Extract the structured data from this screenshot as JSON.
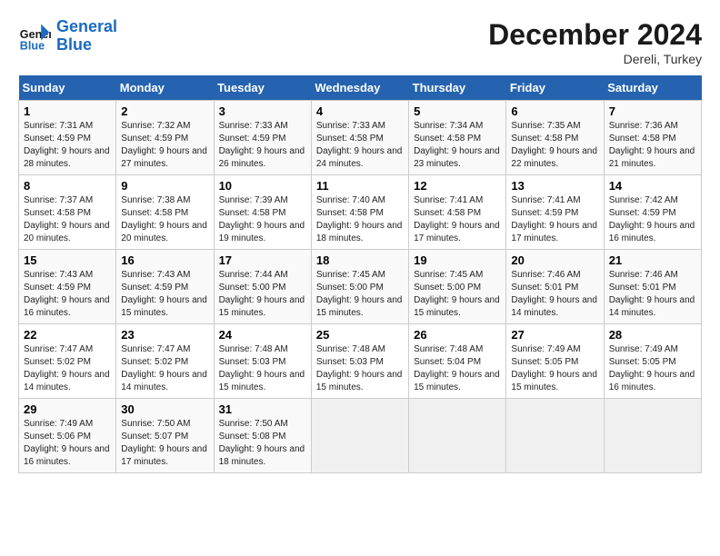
{
  "header": {
    "logo_line1": "General",
    "logo_line2": "Blue",
    "month_year": "December 2024",
    "location": "Dereli, Turkey"
  },
  "weekdays": [
    "Sunday",
    "Monday",
    "Tuesday",
    "Wednesday",
    "Thursday",
    "Friday",
    "Saturday"
  ],
  "weeks": [
    [
      {
        "day": "1",
        "sunrise": "Sunrise: 7:31 AM",
        "sunset": "Sunset: 4:59 PM",
        "daylight": "Daylight: 9 hours and 28 minutes."
      },
      {
        "day": "2",
        "sunrise": "Sunrise: 7:32 AM",
        "sunset": "Sunset: 4:59 PM",
        "daylight": "Daylight: 9 hours and 27 minutes."
      },
      {
        "day": "3",
        "sunrise": "Sunrise: 7:33 AM",
        "sunset": "Sunset: 4:59 PM",
        "daylight": "Daylight: 9 hours and 26 minutes."
      },
      {
        "day": "4",
        "sunrise": "Sunrise: 7:33 AM",
        "sunset": "Sunset: 4:58 PM",
        "daylight": "Daylight: 9 hours and 24 minutes."
      },
      {
        "day": "5",
        "sunrise": "Sunrise: 7:34 AM",
        "sunset": "Sunset: 4:58 PM",
        "daylight": "Daylight: 9 hours and 23 minutes."
      },
      {
        "day": "6",
        "sunrise": "Sunrise: 7:35 AM",
        "sunset": "Sunset: 4:58 PM",
        "daylight": "Daylight: 9 hours and 22 minutes."
      },
      {
        "day": "7",
        "sunrise": "Sunrise: 7:36 AM",
        "sunset": "Sunset: 4:58 PM",
        "daylight": "Daylight: 9 hours and 21 minutes."
      }
    ],
    [
      {
        "day": "8",
        "sunrise": "Sunrise: 7:37 AM",
        "sunset": "Sunset: 4:58 PM",
        "daylight": "Daylight: 9 hours and 20 minutes."
      },
      {
        "day": "9",
        "sunrise": "Sunrise: 7:38 AM",
        "sunset": "Sunset: 4:58 PM",
        "daylight": "Daylight: 9 hours and 20 minutes."
      },
      {
        "day": "10",
        "sunrise": "Sunrise: 7:39 AM",
        "sunset": "Sunset: 4:58 PM",
        "daylight": "Daylight: 9 hours and 19 minutes."
      },
      {
        "day": "11",
        "sunrise": "Sunrise: 7:40 AM",
        "sunset": "Sunset: 4:58 PM",
        "daylight": "Daylight: 9 hours and 18 minutes."
      },
      {
        "day": "12",
        "sunrise": "Sunrise: 7:41 AM",
        "sunset": "Sunset: 4:58 PM",
        "daylight": "Daylight: 9 hours and 17 minutes."
      },
      {
        "day": "13",
        "sunrise": "Sunrise: 7:41 AM",
        "sunset": "Sunset: 4:59 PM",
        "daylight": "Daylight: 9 hours and 17 minutes."
      },
      {
        "day": "14",
        "sunrise": "Sunrise: 7:42 AM",
        "sunset": "Sunset: 4:59 PM",
        "daylight": "Daylight: 9 hours and 16 minutes."
      }
    ],
    [
      {
        "day": "15",
        "sunrise": "Sunrise: 7:43 AM",
        "sunset": "Sunset: 4:59 PM",
        "daylight": "Daylight: 9 hours and 16 minutes."
      },
      {
        "day": "16",
        "sunrise": "Sunrise: 7:43 AM",
        "sunset": "Sunset: 4:59 PM",
        "daylight": "Daylight: 9 hours and 15 minutes."
      },
      {
        "day": "17",
        "sunrise": "Sunrise: 7:44 AM",
        "sunset": "Sunset: 5:00 PM",
        "daylight": "Daylight: 9 hours and 15 minutes."
      },
      {
        "day": "18",
        "sunrise": "Sunrise: 7:45 AM",
        "sunset": "Sunset: 5:00 PM",
        "daylight": "Daylight: 9 hours and 15 minutes."
      },
      {
        "day": "19",
        "sunrise": "Sunrise: 7:45 AM",
        "sunset": "Sunset: 5:00 PM",
        "daylight": "Daylight: 9 hours and 15 minutes."
      },
      {
        "day": "20",
        "sunrise": "Sunrise: 7:46 AM",
        "sunset": "Sunset: 5:01 PM",
        "daylight": "Daylight: 9 hours and 14 minutes."
      },
      {
        "day": "21",
        "sunrise": "Sunrise: 7:46 AM",
        "sunset": "Sunset: 5:01 PM",
        "daylight": "Daylight: 9 hours and 14 minutes."
      }
    ],
    [
      {
        "day": "22",
        "sunrise": "Sunrise: 7:47 AM",
        "sunset": "Sunset: 5:02 PM",
        "daylight": "Daylight: 9 hours and 14 minutes."
      },
      {
        "day": "23",
        "sunrise": "Sunrise: 7:47 AM",
        "sunset": "Sunset: 5:02 PM",
        "daylight": "Daylight: 9 hours and 14 minutes."
      },
      {
        "day": "24",
        "sunrise": "Sunrise: 7:48 AM",
        "sunset": "Sunset: 5:03 PM",
        "daylight": "Daylight: 9 hours and 15 minutes."
      },
      {
        "day": "25",
        "sunrise": "Sunrise: 7:48 AM",
        "sunset": "Sunset: 5:03 PM",
        "daylight": "Daylight: 9 hours and 15 minutes."
      },
      {
        "day": "26",
        "sunrise": "Sunrise: 7:48 AM",
        "sunset": "Sunset: 5:04 PM",
        "daylight": "Daylight: 9 hours and 15 minutes."
      },
      {
        "day": "27",
        "sunrise": "Sunrise: 7:49 AM",
        "sunset": "Sunset: 5:05 PM",
        "daylight": "Daylight: 9 hours and 15 minutes."
      },
      {
        "day": "28",
        "sunrise": "Sunrise: 7:49 AM",
        "sunset": "Sunset: 5:05 PM",
        "daylight": "Daylight: 9 hours and 16 minutes."
      }
    ],
    [
      {
        "day": "29",
        "sunrise": "Sunrise: 7:49 AM",
        "sunset": "Sunset: 5:06 PM",
        "daylight": "Daylight: 9 hours and 16 minutes."
      },
      {
        "day": "30",
        "sunrise": "Sunrise: 7:50 AM",
        "sunset": "Sunset: 5:07 PM",
        "daylight": "Daylight: 9 hours and 17 minutes."
      },
      {
        "day": "31",
        "sunrise": "Sunrise: 7:50 AM",
        "sunset": "Sunset: 5:08 PM",
        "daylight": "Daylight: 9 hours and 18 minutes."
      },
      null,
      null,
      null,
      null
    ]
  ]
}
